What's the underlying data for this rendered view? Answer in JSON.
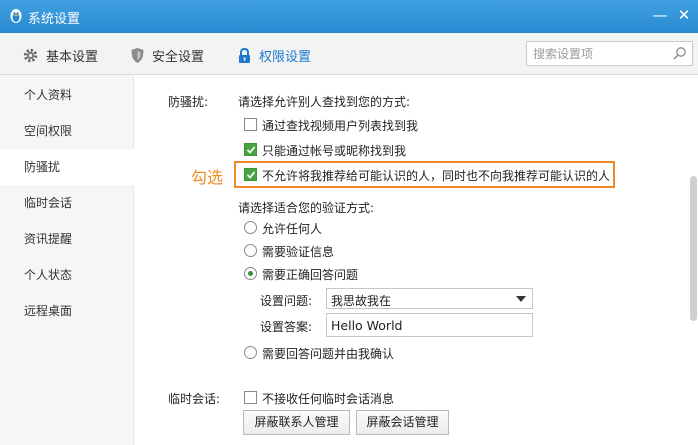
{
  "window": {
    "title": "系统设置",
    "minimize": "—",
    "close": "✕"
  },
  "toolbar": {
    "tabs": [
      {
        "label": "基本设置",
        "icon": "gear-icon"
      },
      {
        "label": "安全设置",
        "icon": "shield-icon"
      },
      {
        "label": "权限设置",
        "icon": "lock-icon",
        "active": true
      }
    ],
    "search_placeholder": "搜索设置项"
  },
  "sidebar": {
    "items": [
      {
        "label": "个人资料"
      },
      {
        "label": "空间权限"
      },
      {
        "label": "防骚扰",
        "active": true
      },
      {
        "label": "临时会话"
      },
      {
        "label": "资讯提醒"
      },
      {
        "label": "个人状态"
      },
      {
        "label": "远程桌面"
      }
    ]
  },
  "anti_harassment": {
    "section_label": "防骚扰:",
    "find_prompt": "请选择允许别人查找到您的方式:",
    "find_options": [
      {
        "label": "通过查找视频用户列表找到我",
        "checked": false
      },
      {
        "label": "只能通过帐号或昵称找到我",
        "checked": true
      },
      {
        "label": "不允许将我推荐给可能认识的人，同时也不向我推荐可能认识的人",
        "checked": true
      }
    ],
    "annotation": "勾选",
    "verify_prompt": "请选择适合您的验证方式:",
    "verify_options": [
      {
        "label": "允许任何人",
        "selected": false
      },
      {
        "label": "需要验证信息",
        "selected": false
      },
      {
        "label": "需要正确回答问题",
        "selected": true
      },
      {
        "label": "需要回答问题并由我确认",
        "selected": false
      }
    ],
    "question_label": "设置问题:",
    "question_value": "我思故我在",
    "answer_label": "设置答案:",
    "answer_value": "Hello World"
  },
  "temp_session": {
    "section_label": "临时会话:",
    "option": {
      "label": "不接收任何临时会话消息",
      "checked": false
    },
    "buttons": {
      "block_contacts": "屏蔽联系人管理",
      "block_sessions": "屏蔽会话管理"
    }
  },
  "colors": {
    "titlebar": "#2b8bd2",
    "accent": "#1e7ad1",
    "check": "#46a540",
    "highlight": "#f08a24"
  }
}
